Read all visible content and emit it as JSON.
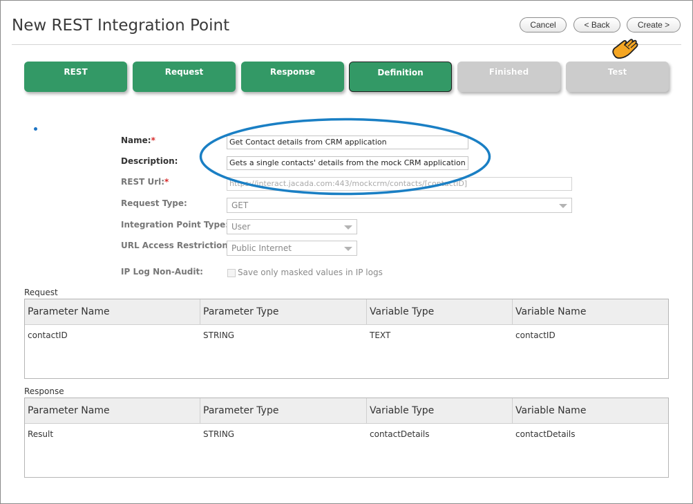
{
  "page": {
    "title": "New REST Integration Point"
  },
  "toolbar": {
    "cancel_label": "Cancel",
    "back_label": "< Back",
    "create_label": "Create >"
  },
  "wizard": {
    "steps": [
      {
        "label": "REST",
        "state": "done"
      },
      {
        "label": "Request",
        "state": "done"
      },
      {
        "label": "Response",
        "state": "done"
      },
      {
        "label": "Definition",
        "state": "active"
      },
      {
        "label": "Finished",
        "state": "pending"
      },
      {
        "label": "Test",
        "state": "pending"
      }
    ]
  },
  "form": {
    "name": {
      "label": "Name:",
      "required": "*",
      "value": "Get Contact details from CRM application"
    },
    "description": {
      "label": "Description:",
      "value": "Gets a single contacts' details from the mock CRM application"
    },
    "rest_url": {
      "label": "REST Url:",
      "required": "*",
      "value": "https://interact.jacada.com:443/mockcrm/contacts/[contactID]"
    },
    "request_type": {
      "label": "Request Type:",
      "value": "GET"
    },
    "integration_point_type": {
      "label": "Integration Point Type:",
      "value": "User"
    },
    "url_access_restriction": {
      "label": "URL Access Restriction:",
      "value": "Public Internet"
    },
    "ip_log": {
      "label": "IP Log Non-Audit:",
      "checkbox_label": "Save only masked values in IP logs"
    }
  },
  "request": {
    "title": "Request",
    "columns": [
      "Parameter Name",
      "Parameter Type",
      "Variable Type",
      "Variable Name"
    ],
    "rows": [
      [
        "contactID",
        "STRING",
        "TEXT",
        "contactID"
      ]
    ]
  },
  "response": {
    "title": "Response",
    "columns": [
      "Parameter Name",
      "Parameter Type",
      "Variable Type",
      "Variable Name"
    ],
    "rows": [
      [
        "Result",
        "STRING",
        "contactDetails",
        "contactDetails"
      ]
    ]
  },
  "colors": {
    "step_done": "#339966",
    "step_pending": "#cccccc",
    "highlight": "#1a7fc4",
    "required": "#d62b2b"
  }
}
